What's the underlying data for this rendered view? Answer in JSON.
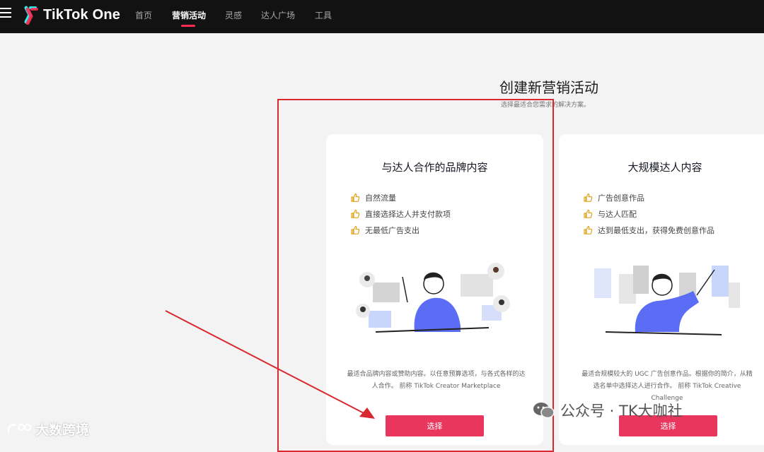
{
  "header": {
    "brand": "TikTok One",
    "nav": [
      {
        "label": "首页",
        "active": false
      },
      {
        "label": "营销活动",
        "active": true
      },
      {
        "label": "灵感",
        "active": false
      },
      {
        "label": "达人广场",
        "active": false
      },
      {
        "label": "工具",
        "active": false
      }
    ]
  },
  "page": {
    "title": "创建新营销活动",
    "subtitle": "选择最适合您需求的解决方案。"
  },
  "cards": [
    {
      "title": "与达人合作的品牌内容",
      "features": [
        "自然流量",
        "直接选择达人并支付款项",
        "无最低广告支出"
      ],
      "description": "最适合品牌内容或赞助内容。以任意预算选项，与各式各样的达人合作。 前称 TikTok Creator Marketplace",
      "button": "选择"
    },
    {
      "title": "大规模达人内容",
      "features": [
        "广告创意作品",
        "与达人匹配",
        "达到最低支出，获得免费创意作品"
      ],
      "description": "最适合规模较大的 UGC 广告创意作品。根据你的简介，从精选名单中选择达人进行合作。 前称 TikTok Creative Challenge",
      "button": "选择"
    }
  ],
  "watermarks": {
    "left": "大数跨境",
    "right": "公众号 · TK大咖社"
  },
  "colors": {
    "accent": "#e8365d",
    "annotation": "#d9282f",
    "topbar": "#121212"
  }
}
